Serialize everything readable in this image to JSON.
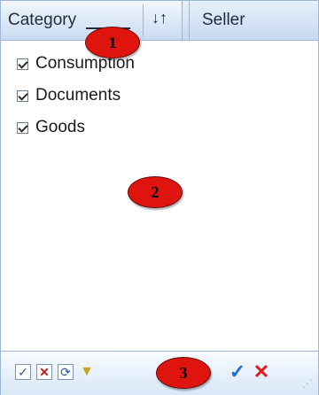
{
  "header": {
    "category_label": "Category",
    "seller_label": "Seller",
    "sort_glyph": "↓↑"
  },
  "list": {
    "items": [
      {
        "label": "Consumption",
        "checked": true
      },
      {
        "label": "Documents",
        "checked": true
      },
      {
        "label": "Goods",
        "checked": true
      }
    ]
  },
  "toolbar": {
    "buttons": [
      {
        "name": "check-all-icon",
        "glyph": "✓"
      },
      {
        "name": "uncheck-all-icon",
        "glyph": "✕"
      },
      {
        "name": "refresh-icon",
        "glyph": "⟳"
      },
      {
        "name": "filter-icon",
        "glyph": "▼"
      },
      {
        "name": "ok-icon",
        "glyph": "✓"
      },
      {
        "name": "cancel-icon",
        "glyph": "✕"
      }
    ],
    "grip_glyph": "⋰"
  },
  "callouts": [
    "1",
    "2",
    "3"
  ],
  "colors": {
    "header_gradient_top": "#e7f0fb",
    "header_gradient_bottom": "#c7d9f0",
    "border": "#9fb6d2",
    "callout_red": "#e0140f",
    "ok_blue": "#1f6fd8",
    "cancel_red": "#e21b1b"
  }
}
